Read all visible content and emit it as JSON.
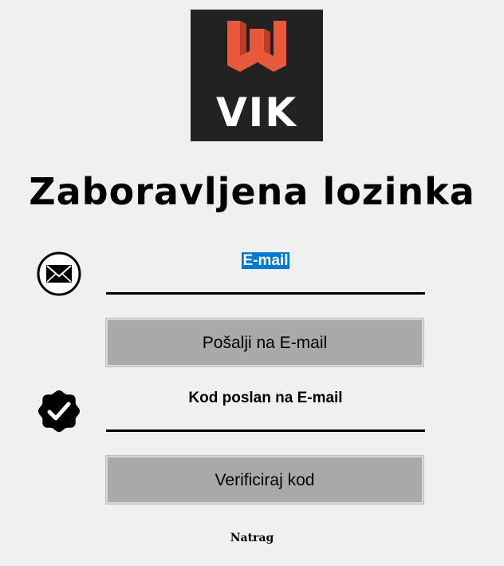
{
  "logo": {
    "text": "VIK",
    "colors": {
      "background": "#222222",
      "mark": "#e8593c",
      "text": "#ffffff"
    }
  },
  "title": "Zaboravljena lozinka",
  "email_field": {
    "icon": "envelope-icon",
    "value": "E-mail",
    "selected": true
  },
  "send_button": {
    "label": "Pošalji na E-mail"
  },
  "code_field": {
    "icon": "verified-badge-icon",
    "value": "Kod poslan na E-mail"
  },
  "verify_button": {
    "label": "Verificiraj kod"
  },
  "back_link": {
    "label": "Natrag"
  },
  "colors": {
    "background": "#f0f0f0",
    "button": "#a9a9a9",
    "selection": "#0078d7"
  }
}
